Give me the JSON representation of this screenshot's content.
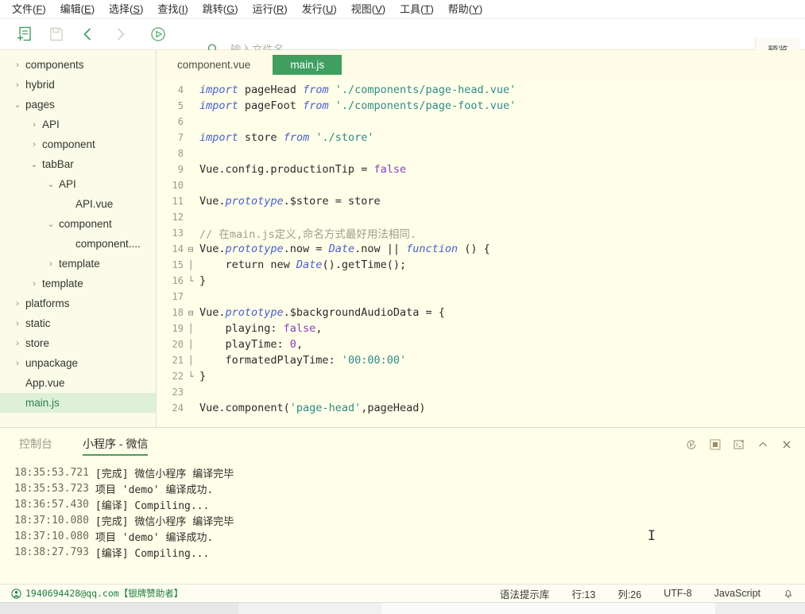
{
  "menubar": {
    "items": [
      {
        "name": "文件",
        "key": "F"
      },
      {
        "name": "编辑",
        "key": "E"
      },
      {
        "name": "选择",
        "key": "S"
      },
      {
        "name": "查找",
        "key": "I"
      },
      {
        "name": "跳转",
        "key": "G"
      },
      {
        "name": "运行",
        "key": "R"
      },
      {
        "name": "发行",
        "key": "U"
      },
      {
        "name": "视图",
        "key": "V"
      },
      {
        "name": "工具",
        "key": "T"
      },
      {
        "name": "帮助",
        "key": "Y"
      }
    ]
  },
  "toolbar": {
    "buttons": [
      {
        "icon": "new-file-icon",
        "enabled": true
      },
      {
        "icon": "save-icon",
        "enabled": false
      },
      {
        "icon": "back-arrow-icon",
        "enabled": true
      },
      {
        "icon": "forward-arrow-icon",
        "enabled": false
      },
      {
        "icon": "run-icon",
        "enabled": true
      }
    ],
    "search": {
      "icon": "search-file-icon",
      "value": "",
      "placeholder": "输入文件名"
    },
    "preview_label": "预览"
  },
  "sidebar": {
    "items": [
      {
        "label": "components",
        "depth": 0,
        "state": "collapsed",
        "type": "folder"
      },
      {
        "label": "hybrid",
        "depth": 0,
        "state": "collapsed",
        "type": "folder"
      },
      {
        "label": "pages",
        "depth": 0,
        "state": "expanded",
        "type": "folder"
      },
      {
        "label": "API",
        "depth": 1,
        "state": "collapsed",
        "type": "folder"
      },
      {
        "label": "component",
        "depth": 1,
        "state": "collapsed",
        "type": "folder"
      },
      {
        "label": "tabBar",
        "depth": 1,
        "state": "expanded",
        "type": "folder"
      },
      {
        "label": "API",
        "depth": 2,
        "state": "expanded",
        "type": "folder"
      },
      {
        "label": "API.vue",
        "depth": 3,
        "state": "leaf",
        "type": "file"
      },
      {
        "label": "component",
        "depth": 2,
        "state": "expanded",
        "type": "folder"
      },
      {
        "label": "component....",
        "depth": 3,
        "state": "leaf",
        "type": "file"
      },
      {
        "label": "template",
        "depth": 2,
        "state": "collapsed",
        "type": "folder"
      },
      {
        "label": "template",
        "depth": 1,
        "state": "collapsed",
        "type": "folder"
      },
      {
        "label": "platforms",
        "depth": 0,
        "state": "collapsed",
        "type": "folder"
      },
      {
        "label": "static",
        "depth": 0,
        "state": "collapsed",
        "type": "folder"
      },
      {
        "label": "store",
        "depth": 0,
        "state": "collapsed",
        "type": "folder"
      },
      {
        "label": "unpackage",
        "depth": 0,
        "state": "collapsed",
        "type": "folder"
      },
      {
        "label": "App.vue",
        "depth": 0,
        "state": "leaf",
        "type": "file"
      },
      {
        "label": "main.js",
        "depth": 0,
        "state": "leaf",
        "type": "file",
        "selected": true
      }
    ]
  },
  "editor": {
    "tabs": [
      {
        "label": "component.vue",
        "active": false
      },
      {
        "label": "main.js",
        "active": true
      }
    ],
    "first_line_number": 4,
    "lines": [
      {
        "n": "4",
        "fold": "",
        "tokens": [
          {
            "t": "import",
            "c": "k"
          },
          {
            "t": " pageHead ",
            "c": "kw"
          },
          {
            "t": "from",
            "c": "k"
          },
          {
            "t": " ",
            "c": "kw"
          },
          {
            "t": "'./components/page-head.vue'",
            "c": "str"
          }
        ]
      },
      {
        "n": "5",
        "fold": "",
        "tokens": [
          {
            "t": "import",
            "c": "k"
          },
          {
            "t": " pageFoot ",
            "c": "kw"
          },
          {
            "t": "from",
            "c": "k"
          },
          {
            "t": " ",
            "c": "kw"
          },
          {
            "t": "'./components/page-foot.vue'",
            "c": "str"
          }
        ]
      },
      {
        "n": "6",
        "fold": "",
        "tokens": []
      },
      {
        "n": "7",
        "fold": "",
        "tokens": [
          {
            "t": "import",
            "c": "k"
          },
          {
            "t": " store ",
            "c": "kw"
          },
          {
            "t": "from",
            "c": "k"
          },
          {
            "t": " ",
            "c": "kw"
          },
          {
            "t": "'./store'",
            "c": "str"
          }
        ]
      },
      {
        "n": "8",
        "fold": "",
        "tokens": []
      },
      {
        "n": "9",
        "fold": "",
        "tokens": [
          {
            "t": "Vue.config.productionTip = ",
            "c": "kw"
          },
          {
            "t": "false",
            "c": "num"
          }
        ]
      },
      {
        "n": "10",
        "fold": "",
        "tokens": []
      },
      {
        "n": "11",
        "fold": "",
        "tokens": [
          {
            "t": "Vue.",
            "c": "kw"
          },
          {
            "t": "prototype",
            "c": "k"
          },
          {
            "t": ".$store = store",
            "c": "kw"
          }
        ]
      },
      {
        "n": "12",
        "fold": "",
        "tokens": []
      },
      {
        "n": "13",
        "fold": "",
        "tokens": [
          {
            "t": "// 在main.js定义,命名方式最好用法相同.",
            "c": "cm"
          }
        ]
      },
      {
        "n": "14",
        "fold": "⊟",
        "tokens": [
          {
            "t": "Vue.",
            "c": "kw"
          },
          {
            "t": "prototype",
            "c": "k"
          },
          {
            "t": ".now = ",
            "c": "kw"
          },
          {
            "t": "Date",
            "c": "cls"
          },
          {
            "t": ".now || ",
            "c": "kw"
          },
          {
            "t": "function",
            "c": "k"
          },
          {
            "t": " () {",
            "c": "kw"
          }
        ]
      },
      {
        "n": "15",
        "fold": "│",
        "tokens": [
          {
            "t": "    return new ",
            "c": "kw"
          },
          {
            "t": "Date",
            "c": "cls"
          },
          {
            "t": "().getTime();",
            "c": "kw"
          }
        ]
      },
      {
        "n": "16",
        "fold": "└",
        "tokens": [
          {
            "t": "}",
            "c": "kw"
          }
        ]
      },
      {
        "n": "17",
        "fold": "",
        "tokens": []
      },
      {
        "n": "18",
        "fold": "⊟",
        "tokens": [
          {
            "t": "Vue.",
            "c": "kw"
          },
          {
            "t": "prototype",
            "c": "k"
          },
          {
            "t": ".$backgroundAudioData = {",
            "c": "kw"
          }
        ]
      },
      {
        "n": "19",
        "fold": "│",
        "tokens": [
          {
            "t": "    playing: ",
            "c": "kw"
          },
          {
            "t": "false",
            "c": "num"
          },
          {
            "t": ",",
            "c": "kw"
          }
        ]
      },
      {
        "n": "20",
        "fold": "│",
        "tokens": [
          {
            "t": "    playTime: ",
            "c": "kw"
          },
          {
            "t": "0",
            "c": "num"
          },
          {
            "t": ",",
            "c": "kw"
          }
        ]
      },
      {
        "n": "21",
        "fold": "│",
        "tokens": [
          {
            "t": "    formatedPlayTime: ",
            "c": "kw"
          },
          {
            "t": "'00:00:00'",
            "c": "str"
          }
        ]
      },
      {
        "n": "22",
        "fold": "└",
        "tokens": [
          {
            "t": "}",
            "c": "kw"
          }
        ]
      },
      {
        "n": "23",
        "fold": "",
        "tokens": []
      },
      {
        "n": "24",
        "fold": "",
        "tokens": [
          {
            "t": "Vue.component(",
            "c": "kw"
          },
          {
            "t": "'page-head'",
            "c": "str"
          },
          {
            "t": ",pageHead)",
            "c": "kw"
          }
        ]
      }
    ]
  },
  "console": {
    "tabs": [
      {
        "label": "控制台",
        "active": false
      },
      {
        "label": "小程序 - 微信",
        "active": true
      }
    ],
    "actions": [
      {
        "icon": "restart-icon"
      },
      {
        "icon": "stop-icon"
      },
      {
        "icon": "new-terminal-icon"
      },
      {
        "icon": "collapse-up-icon"
      },
      {
        "icon": "close-icon"
      }
    ],
    "logs": [
      {
        "time": "18:35:53.721",
        "msg": "[完成] 微信小程序 编译完毕"
      },
      {
        "time": "18:35:53.723",
        "msg": "项目 'demo' 编译成功."
      },
      {
        "time": "18:36:57.430",
        "msg": "[编译] Compiling..."
      },
      {
        "time": "18:37:10.080",
        "msg": "[完成] 微信小程序 编译完毕"
      },
      {
        "time": "18:37:10.080",
        "msg": "项目 'demo' 编译成功."
      },
      {
        "time": "18:38:27.793",
        "msg": "[编译] Compiling..."
      }
    ]
  },
  "statusbar": {
    "account_icon": "user-icon",
    "account": "1940694428@qq.com【银牌赞助者】",
    "items": [
      {
        "label": "语法提示库"
      },
      {
        "label": "行:13"
      },
      {
        "label": "列:26"
      },
      {
        "label": "UTF-8"
      },
      {
        "label": "JavaScript"
      }
    ],
    "bell_icon": "bell-icon"
  },
  "colors": {
    "accent_green": "#3f9e60",
    "editor_bg": "#fefee9",
    "sidebar_bg": "#fbfbe9",
    "selection_bg": "#dff0d8",
    "string": "#2e8b8b",
    "keyword": "#4a5fd0",
    "number": "#8a3fc0",
    "comment": "#a0a090"
  }
}
